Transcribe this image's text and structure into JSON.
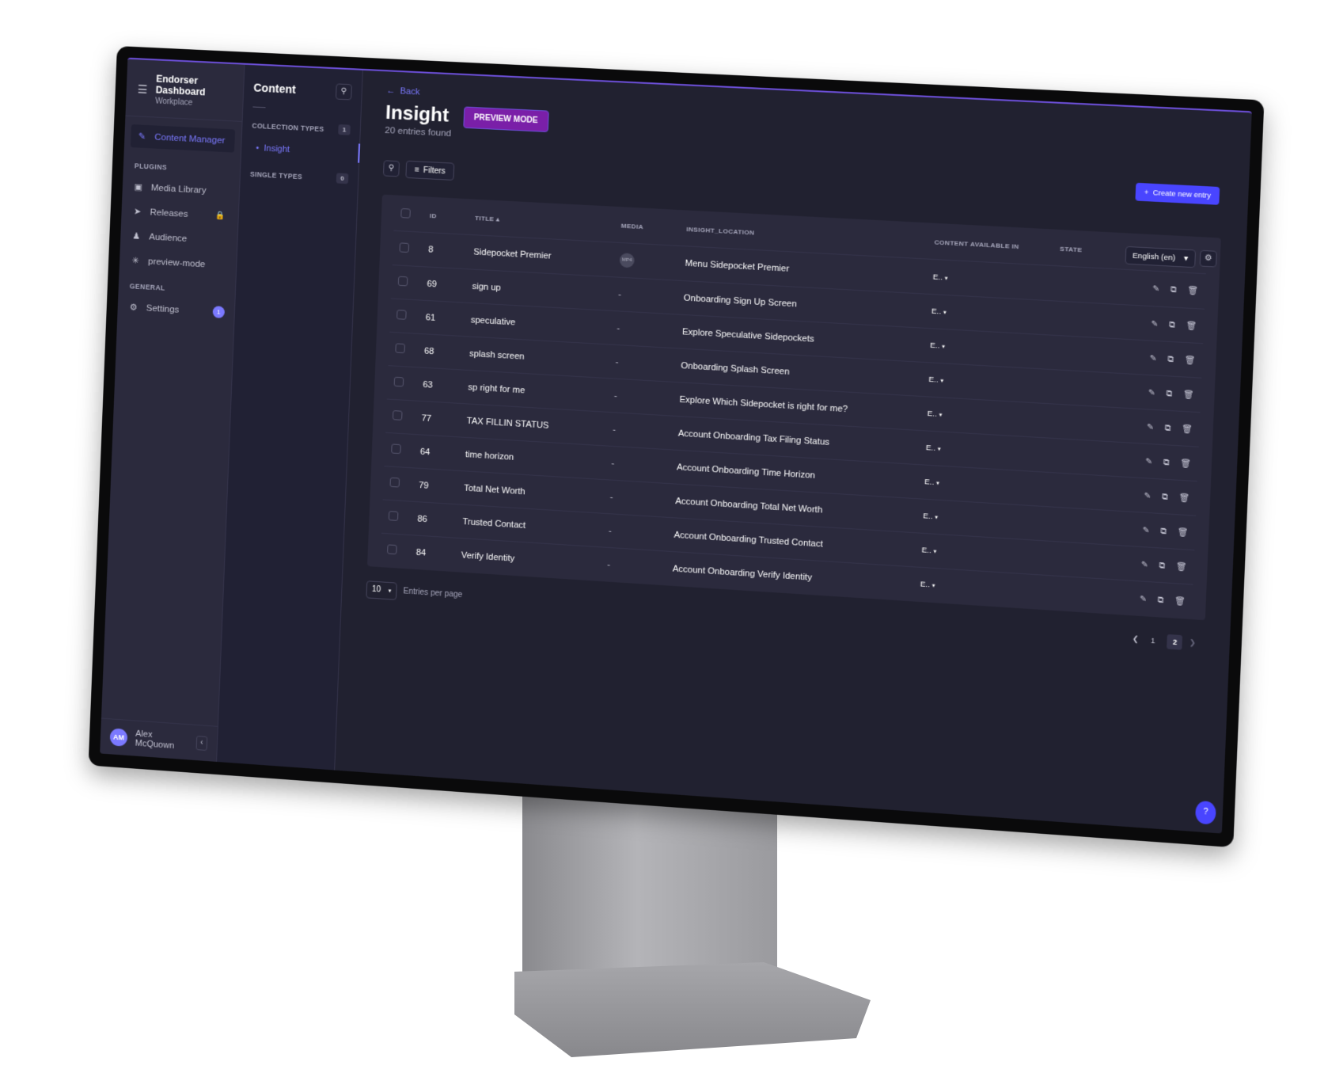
{
  "app": {
    "brand_title": "Endorser Dashboard",
    "brand_subtitle": "Workplace"
  },
  "mainnav": {
    "active_item": "Content Manager",
    "plugins_label": "PLUGINS",
    "plugins": [
      {
        "label": "Media Library",
        "icon": "image-icon"
      },
      {
        "label": "Releases",
        "icon": "paper-plane-icon",
        "locked": true
      },
      {
        "label": "Audience",
        "icon": "users-icon"
      },
      {
        "label": "preview-mode",
        "icon": "puzzle-icon"
      }
    ],
    "general_label": "GENERAL",
    "settings_label": "Settings",
    "settings_badge": "1",
    "user_initials": "AM",
    "user_name": "Alex McQuown"
  },
  "subnav": {
    "title": "Content",
    "collection_types_label": "COLLECTION TYPES",
    "collection_types_count": "1",
    "collection_items": [
      "Insight"
    ],
    "single_types_label": "SINGLE TYPES",
    "single_types_count": "0"
  },
  "content": {
    "back_label": "Back",
    "page_title": "Insight",
    "preview_mode_label": "PREVIEW MODE",
    "entries_found": "20 entries found",
    "create_label": "Create new entry",
    "filters_label": "Filters",
    "locale_label": "English (en)",
    "columns": [
      "ID",
      "TITLE",
      "MEDIA",
      "INSIGHT_LOCATION",
      "CONTENT AVAILABLE IN",
      "STATE"
    ],
    "rows": [
      {
        "id": "8",
        "title": "Sidepocket Premier",
        "media": "MP4",
        "location": "Menu Sidepocket Premier",
        "locale": "E.."
      },
      {
        "id": "69",
        "title": "sign up",
        "media": "-",
        "location": "Onboarding Sign Up Screen",
        "locale": "E.."
      },
      {
        "id": "61",
        "title": "speculative",
        "media": "-",
        "location": "Explore Speculative Sidepockets",
        "locale": "E.."
      },
      {
        "id": "68",
        "title": "splash screen",
        "media": "-",
        "location": "Onboarding Splash Screen",
        "locale": "E.."
      },
      {
        "id": "63",
        "title": "sp right for me",
        "media": "-",
        "location": "Explore Which Sidepocket is right for me?",
        "locale": "E.."
      },
      {
        "id": "77",
        "title": "TAX FILLIN STATUS",
        "media": "-",
        "location": "Account Onboarding Tax Filing Status",
        "locale": "E.."
      },
      {
        "id": "64",
        "title": "time horizon",
        "media": "-",
        "location": "Account Onboarding Time Horizon",
        "locale": "E.."
      },
      {
        "id": "79",
        "title": "Total Net Worth",
        "media": "-",
        "location": "Account Onboarding Total Net Worth",
        "locale": "E.."
      },
      {
        "id": "86",
        "title": "Trusted Contact",
        "media": "-",
        "location": "Account Onboarding Trusted Contact",
        "locale": "E.."
      },
      {
        "id": "84",
        "title": "Verify Identity",
        "media": "-",
        "location": "Account Onboarding Verify Identity",
        "locale": "E.."
      }
    ],
    "per_page_value": "10",
    "per_page_label": "Entries per page",
    "pages": [
      "1",
      "2"
    ],
    "current_page": "2",
    "help_label": "?"
  },
  "colors": {
    "accent": "#7b79ff",
    "primary_button": "#4945ff",
    "preview_badge": "#7a1fa8",
    "background": "#212130"
  }
}
